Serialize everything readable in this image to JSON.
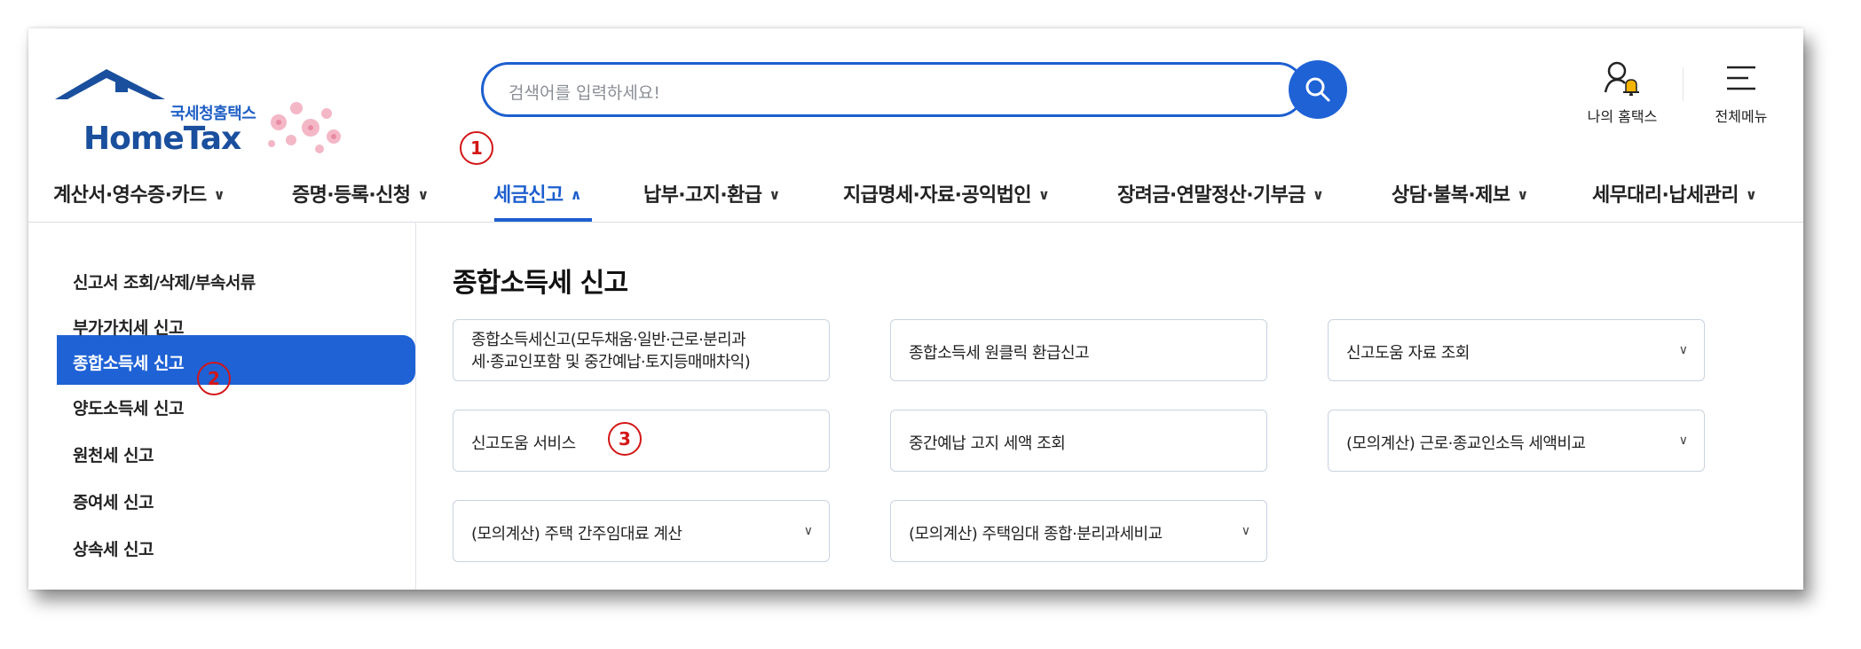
{
  "brand": {
    "korean_name": "국세청홈택스",
    "english_name": "HomeTax"
  },
  "search": {
    "placeholder": "검색어를 입력하세요!"
  },
  "utility": {
    "my_hometax": "나의 홈택스",
    "all_menu": "전체메뉴"
  },
  "gnb": [
    {
      "label": "계산서·영수증·카드",
      "active": false
    },
    {
      "label": "증명·등록·신청",
      "active": false
    },
    {
      "label": "세금신고",
      "active": true
    },
    {
      "label": "납부·고지·환급",
      "active": false
    },
    {
      "label": "지급명세·자료·공익법인",
      "active": false
    },
    {
      "label": "장려금·연말정산·기부금",
      "active": false
    },
    {
      "label": "상담·불복·제보",
      "active": false
    },
    {
      "label": "세무대리·납세관리",
      "active": false
    }
  ],
  "markers": {
    "m1": "1",
    "m2": "2",
    "m3": "3"
  },
  "sidebar": [
    {
      "label": "신고서 조회/삭제/부속서류"
    },
    {
      "label": "부가가치세 신고"
    },
    {
      "label": "종합소득세 신고",
      "active": true
    },
    {
      "label": "양도소득세 신고"
    },
    {
      "label": "원천세 신고"
    },
    {
      "label": "증여세 신고"
    },
    {
      "label": "상속세 신고"
    }
  ],
  "main": {
    "title": "종합소득세 신고",
    "cards": [
      {
        "line1": "종합소득세신고(모두채움·일반·근로·분리과",
        "line2": "세·종교인포함 및 중간예납·토지등매매차익)"
      },
      {
        "label": "종합소득세 원클릭 환급신고"
      },
      {
        "label": "신고도움 자료 조회",
        "dropdown": true
      },
      {
        "label": "신고도움 서비스"
      },
      {
        "label": "중간예납 고지 세액 조회"
      },
      {
        "label": "(모의계산) 근로·종교인소득 세액비교",
        "dropdown": true
      },
      {
        "label": "(모의계산) 주택 간주임대료 계산",
        "dropdown": true
      },
      {
        "label": "(모의계산) 주택임대 종합·분리과세비교",
        "dropdown": true
      }
    ]
  },
  "colors": {
    "primary": "#1f62d6",
    "marker": "#d31616",
    "text": "#222222"
  },
  "icons": [
    "house-logo-icon",
    "cherry-blossom-icon",
    "search-icon",
    "person-bell-icon",
    "hamburger-menu-icon",
    "chevron-down-icon",
    "chevron-up-icon"
  ]
}
